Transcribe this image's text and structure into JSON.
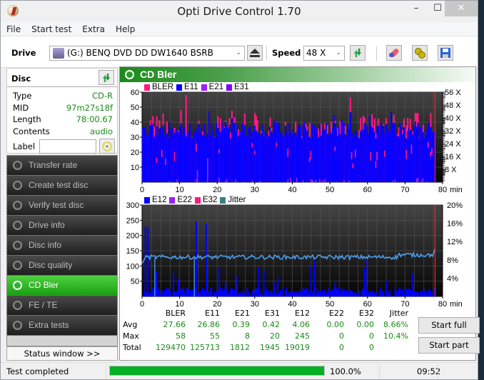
{
  "window": {
    "title": "Opti Drive Control 1.70",
    "minimize": "–",
    "maximize": "☐",
    "close": "✕"
  },
  "menu": [
    "File",
    "Start test",
    "Extra",
    "Help"
  ],
  "toolbar": {
    "drive_label": "Drive",
    "drive_value": "(G:)  BENQ DVD DD DW1640 BSRB",
    "speed_label": "Speed",
    "speed_value": "48 X",
    "icons": [
      "eject-icon",
      "refresh-icon",
      "erase-icon",
      "settings-icon",
      "save-icon"
    ]
  },
  "disc": {
    "header": "Disc",
    "fields": [
      {
        "key": "Type",
        "value": "CD-R"
      },
      {
        "key": "MID",
        "value": "97m27s18f"
      },
      {
        "key": "Length",
        "value": "78:00.67"
      },
      {
        "key": "Contents",
        "value": "audio"
      }
    ],
    "label_key": "Label",
    "label_value": ""
  },
  "nav": [
    {
      "label": "Transfer rate",
      "active": false
    },
    {
      "label": "Create test disc",
      "active": false
    },
    {
      "label": "Verify test disc",
      "active": false
    },
    {
      "label": "Drive info",
      "active": false
    },
    {
      "label": "Disc info",
      "active": false
    },
    {
      "label": "Disc quality",
      "active": false
    },
    {
      "label": "CD Bler",
      "active": true
    },
    {
      "label": "FE / TE",
      "active": false
    },
    {
      "label": "Extra tests",
      "active": false
    }
  ],
  "status_window_button": "Status window >>",
  "panel": {
    "title": "CD Bler"
  },
  "chart_data": [
    {
      "type": "bar",
      "title": "BLER / E11 / E21 / E31",
      "legend": [
        {
          "name": "BLER",
          "color": "#ff1a80"
        },
        {
          "name": "E11",
          "color": "#0000ff"
        },
        {
          "name": "E21",
          "color": "#9a20ff"
        },
        {
          "name": "E31",
          "color": "#8000ff"
        }
      ],
      "legend_placement": "top-left",
      "xlabel": "min",
      "x_ticks": [
        0,
        10,
        20,
        30,
        40,
        50,
        60,
        70,
        80
      ],
      "xlim": [
        0,
        80
      ],
      "y_ticks": [
        10,
        20,
        30,
        40,
        50,
        60
      ],
      "ylim": [
        0,
        60
      ],
      "y2_ticks": [
        "8 X",
        "16 X",
        "24 X",
        "32 X",
        "40 X",
        "48 X",
        "56 X"
      ],
      "y2lim": [
        0,
        56
      ],
      "end_marker_min": 78,
      "series_summary": {
        "BLER_typical": [
          30,
          45
        ],
        "BLER_peak": 58,
        "E11_typical": [
          28,
          42
        ],
        "E11_peak": 55,
        "E21_peak": 8,
        "E31_peak": 20
      }
    },
    {
      "type": "bar",
      "title": "E12 / E22 / E32 / Jitter",
      "legend": [
        {
          "name": "E12",
          "color": "#0000ff"
        },
        {
          "name": "E22",
          "color": "#9a20ff"
        },
        {
          "name": "E32",
          "color": "#ff1a80"
        },
        {
          "name": "Jitter",
          "color": "#3a8080"
        }
      ],
      "legend_placement": "top-left",
      "xlabel": "min",
      "x_ticks": [
        0,
        10,
        20,
        30,
        40,
        50,
        60,
        70,
        80
      ],
      "xlim": [
        0,
        80
      ],
      "y_ticks": [
        50,
        100,
        150,
        200,
        250,
        300
      ],
      "ylim": [
        0,
        300
      ],
      "y2_ticks": [
        "4%",
        "8%",
        "12%",
        "16%",
        "20%"
      ],
      "y2lim": [
        0,
        20
      ],
      "end_marker_min": 78,
      "series_summary": {
        "E12_typical": [
          10,
          30
        ],
        "E12_peaks": [
          [
            0.6,
            230
          ],
          [
            1.2,
            228
          ],
          [
            14.2,
            245
          ],
          [
            17.0,
            238
          ],
          [
            45.8,
            118
          ],
          [
            59.5,
            120
          ]
        ],
        "jitter_percent_typical": [
          8.3,
          9.2
        ],
        "jitter_end_percent": 10.4
      }
    }
  ],
  "stats": {
    "columns": [
      "",
      "BLER",
      "E11",
      "E21",
      "E31",
      "E12",
      "E22",
      "E32",
      "Jitter"
    ],
    "rows": [
      {
        "label": "Avg",
        "values": [
          "27.66",
          "26.86",
          "0.39",
          "0.42",
          "4.06",
          "0.00",
          "0.00",
          "8.66%"
        ]
      },
      {
        "label": "Max",
        "values": [
          "58",
          "55",
          "8",
          "20",
          "245",
          "0",
          "0",
          "10.4%"
        ]
      },
      {
        "label": "Total",
        "values": [
          "129470",
          "125713",
          "1812",
          "1945",
          "19019",
          "0",
          "0",
          ""
        ]
      }
    ]
  },
  "buttons": {
    "start_full": "Start full",
    "start_part": "Start part"
  },
  "statusbar": {
    "text": "Test completed",
    "progress_percent": 100,
    "progress_label": "100.0%",
    "time": "09:52"
  }
}
